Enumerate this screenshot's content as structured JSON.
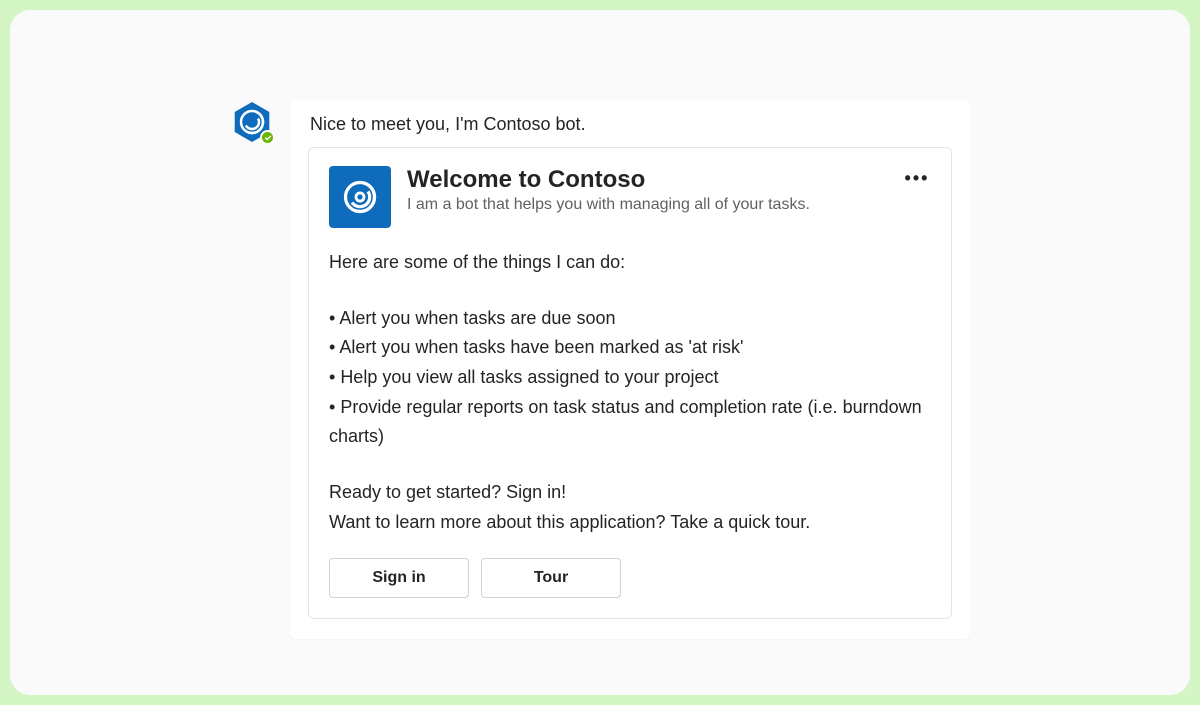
{
  "message": {
    "intro": "Nice to meet you, I'm Contoso bot."
  },
  "card": {
    "title": "Welcome to Contoso",
    "subtitle": "I am a bot that helps you with managing all of your tasks.",
    "body_intro": "Here are some of the things I can do:",
    "bullets": [
      "Alert you when tasks are due soon",
      "Alert you when tasks have been marked as 'at risk'",
      "Help you view all tasks assigned to your project",
      "Provide regular reports on task status and completion rate  (i.e. burndown charts)"
    ],
    "cta_line1": "Ready to get started? Sign in!",
    "cta_line2": "Want to learn more about this application? Take a quick tour.",
    "buttons": {
      "signin": "Sign in",
      "tour": "Tour"
    }
  },
  "colors": {
    "brand": "#0f6cbd",
    "presence": "#6bb700"
  }
}
